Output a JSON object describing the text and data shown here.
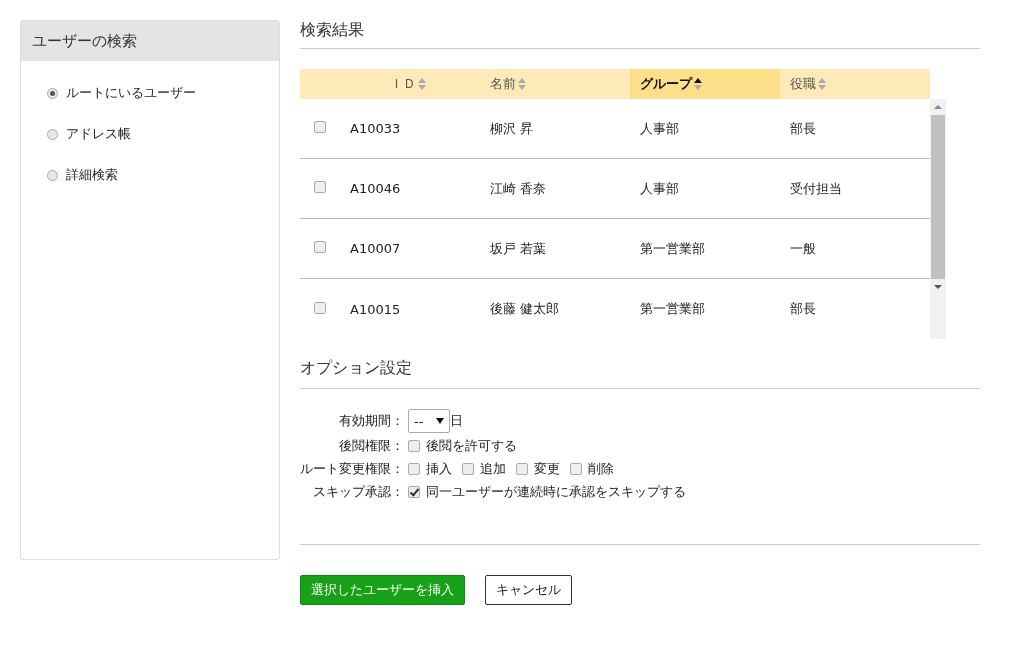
{
  "sidebar": {
    "title": "ユーザーの検索",
    "options": [
      {
        "label": "ルートにいるユーザー",
        "selected": true
      },
      {
        "label": "アドレス帳",
        "selected": false
      },
      {
        "label": "詳細検索",
        "selected": false
      }
    ]
  },
  "results": {
    "title": "検索結果",
    "columns": [
      {
        "label": "ＩＤ",
        "sorted": false
      },
      {
        "label": "名前",
        "sorted": false
      },
      {
        "label": "グループ",
        "sorted": true
      },
      {
        "label": "役職",
        "sorted": false
      }
    ],
    "rows": [
      {
        "checked": false,
        "cells": [
          "A10033",
          "柳沢 昇",
          "人事部",
          "部長"
        ]
      },
      {
        "checked": false,
        "cells": [
          "A10046",
          "江崎 香奈",
          "人事部",
          "受付担当"
        ]
      },
      {
        "checked": false,
        "cells": [
          "A10007",
          "坂戸 若葉",
          "第一営業部",
          "一般"
        ]
      },
      {
        "checked": false,
        "cells": [
          "A10015",
          "後藤 健太郎",
          "第一営業部",
          "部長"
        ]
      }
    ]
  },
  "options": {
    "title": "オプション設定",
    "rows": [
      {
        "kind": "select",
        "label": "有効期間：",
        "value": "--",
        "suffix": "日"
      },
      {
        "kind": "checks",
        "label": "後閲権限：",
        "items": [
          {
            "label": "後閲を許可する",
            "checked": false
          }
        ]
      },
      {
        "kind": "checks",
        "label": "ルート変更権限：",
        "items": [
          {
            "label": "挿入",
            "checked": false
          },
          {
            "label": "追加",
            "checked": false
          },
          {
            "label": "変更",
            "checked": false
          },
          {
            "label": "削除",
            "checked": false
          }
        ]
      },
      {
        "kind": "checks",
        "label": "スキップ承認：",
        "items": [
          {
            "label": "同一ユーザーが連続時に承認をスキップする",
            "checked": true
          }
        ]
      }
    ]
  },
  "buttons": [
    {
      "kind": "primary",
      "label": "選択したユーザーを挿入"
    },
    {
      "kind": "secondary",
      "label": "キャンセル"
    }
  ]
}
